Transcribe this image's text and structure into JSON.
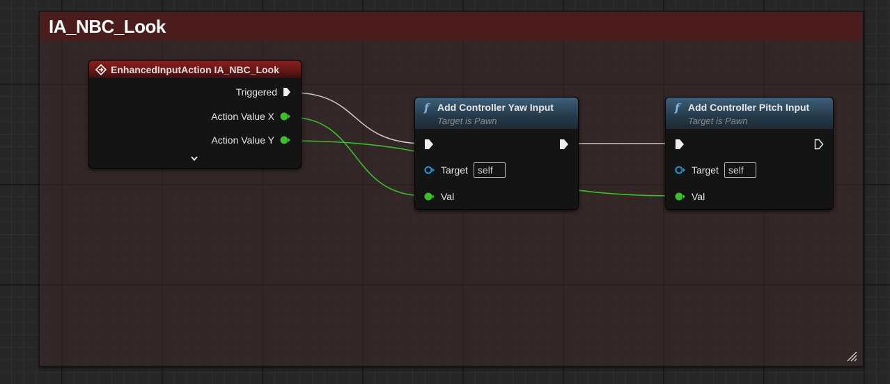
{
  "comment": {
    "title": "IA_NBC_Look"
  },
  "event_node": {
    "title": "EnhancedInputAction IA_NBC_Look",
    "pins": [
      "Triggered",
      "Action Value X",
      "Action Value Y"
    ]
  },
  "yaw_node": {
    "title": "Add Controller Yaw Input",
    "subtitle": "Target is Pawn",
    "target_label": "Target",
    "target_value": "self",
    "val_label": "Val"
  },
  "pitch_node": {
    "title": "Add Controller Pitch Input",
    "subtitle": "Target is Pawn",
    "target_label": "Target",
    "target_value": "self",
    "val_label": "Val"
  },
  "colors": {
    "exec_wire": "#c8c8c8",
    "float_wire": "#39c02a",
    "event_header": "#7a1b1b",
    "function_header": "#355267",
    "object_pin": "#1f9ad6"
  }
}
